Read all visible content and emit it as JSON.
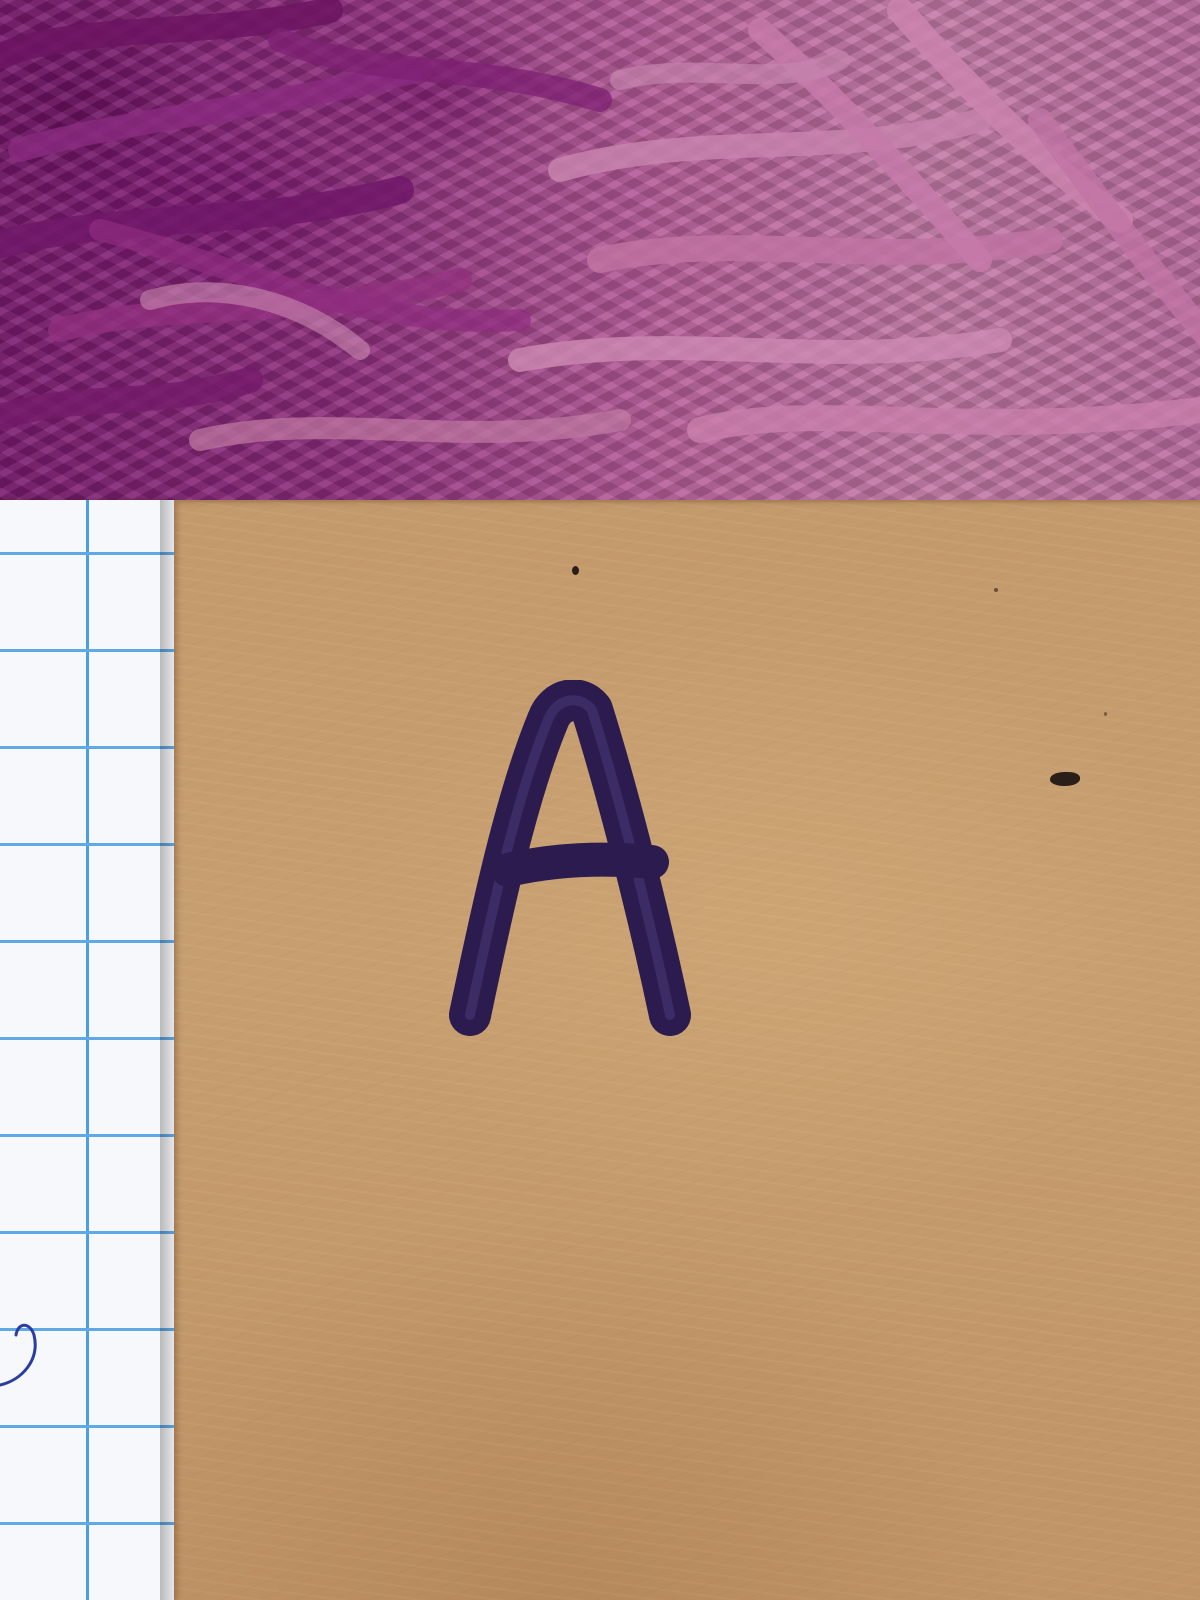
{
  "scene": {
    "background_object": "yarn-rug",
    "left_object": "grid-notebook",
    "main_object": "kraft-paper-cover"
  },
  "handwriting": {
    "letter": "A",
    "ink_color": "#2b1b4f"
  },
  "colors": {
    "yarn_dark": "#7a1a6e",
    "yarn_light": "#c37aa6",
    "kraft": "#c49b6d",
    "grid_line": "#4c9ee2",
    "notebook_paper": "#f6f8fb"
  }
}
